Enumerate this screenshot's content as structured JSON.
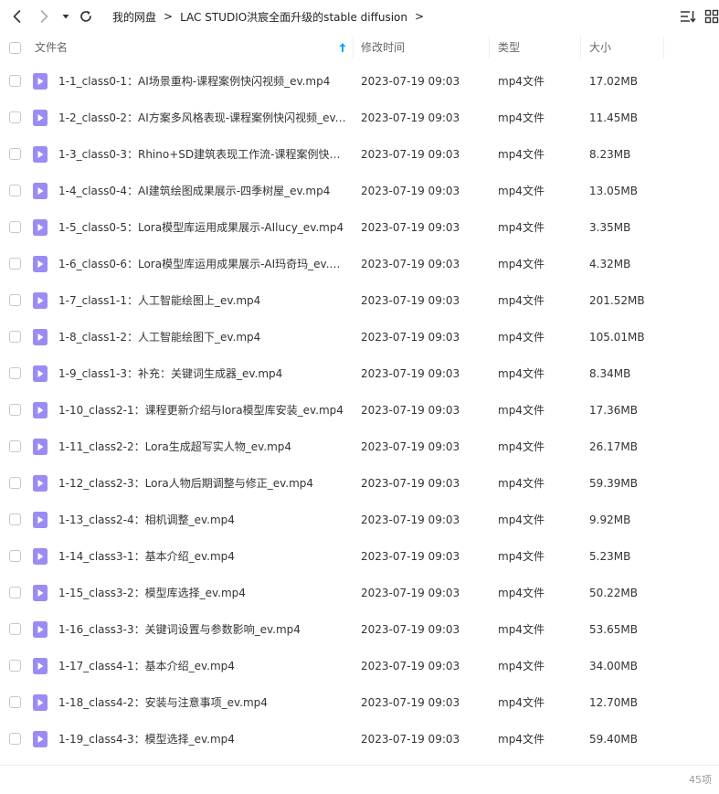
{
  "toolbar": {
    "back_icon": "chevron-left-icon",
    "forward_icon": "chevron-right-icon",
    "history_icon": "caret-down-icon",
    "refresh_icon": "refresh-icon",
    "sort_icon": "sort-list-icon",
    "grid_icon": "grid-view-icon"
  },
  "breadcrumb": {
    "items": [
      "我的网盘",
      "LAC STUDIO洪宸全面升级的stable diffusion"
    ],
    "separator": ">"
  },
  "columns": {
    "name": "文件名",
    "time": "修改时间",
    "type": "类型",
    "size": "大小"
  },
  "colors": {
    "accent": "#06a7ff",
    "file_icon": "#9b8cf4"
  },
  "files": [
    {
      "name": "1-1_class0-1：AI场景重构-课程案例快闪视频_ev.mp4",
      "time": "2023-07-19 09:03",
      "type": "mp4文件",
      "size": "17.02MB"
    },
    {
      "name": "1-2_class0-2：AI方案多风格表现-课程案例快闪视频_ev....",
      "time": "2023-07-19 09:03",
      "type": "mp4文件",
      "size": "11.45MB"
    },
    {
      "name": "1-3_class0-3：Rhino+SD建筑表现工作流-课程案例快闪...",
      "time": "2023-07-19 09:03",
      "type": "mp4文件",
      "size": "8.23MB"
    },
    {
      "name": "1-4_class0-4：AI建筑绘图成果展示-四季树屋_ev.mp4",
      "time": "2023-07-19 09:03",
      "type": "mp4文件",
      "size": "13.05MB"
    },
    {
      "name": "1-5_class0-5：Lora模型库运用成果展示-AIlucy_ev.mp4",
      "time": "2023-07-19 09:03",
      "type": "mp4文件",
      "size": "3.35MB"
    },
    {
      "name": "1-6_class0-6：Lora模型库运用成果展示-AI玛奇玛_ev.m...",
      "time": "2023-07-19 09:03",
      "type": "mp4文件",
      "size": "4.32MB"
    },
    {
      "name": "1-7_class1-1：人工智能绘图上_ev.mp4",
      "time": "2023-07-19 09:03",
      "type": "mp4文件",
      "size": "201.52MB"
    },
    {
      "name": "1-8_class1-2：人工智能绘图下_ev.mp4",
      "time": "2023-07-19 09:03",
      "type": "mp4文件",
      "size": "105.01MB"
    },
    {
      "name": "1-9_class1-3：补充：关键词生成器_ev.mp4",
      "time": "2023-07-19 09:03",
      "type": "mp4文件",
      "size": "8.34MB"
    },
    {
      "name": "1-10_class2-1：课程更新介绍与lora模型库安装_ev.mp4",
      "time": "2023-07-19 09:03",
      "type": "mp4文件",
      "size": "17.36MB"
    },
    {
      "name": "1-11_class2-2：Lora生成超写实人物_ev.mp4",
      "time": "2023-07-19 09:03",
      "type": "mp4文件",
      "size": "26.17MB"
    },
    {
      "name": "1-12_class2-3：Lora人物后期调整与修正_ev.mp4",
      "time": "2023-07-19 09:03",
      "type": "mp4文件",
      "size": "59.39MB"
    },
    {
      "name": "1-13_class2-4：相机调整_ev.mp4",
      "time": "2023-07-19 09:03",
      "type": "mp4文件",
      "size": "9.92MB"
    },
    {
      "name": "1-14_class3-1：基本介绍_ev.mp4",
      "time": "2023-07-19 09:03",
      "type": "mp4文件",
      "size": "5.23MB"
    },
    {
      "name": "1-15_class3-2：模型库选择_ev.mp4",
      "time": "2023-07-19 09:03",
      "type": "mp4文件",
      "size": "50.22MB"
    },
    {
      "name": "1-16_class3-3：关键词设置与参数影响_ev.mp4",
      "time": "2023-07-19 09:03",
      "type": "mp4文件",
      "size": "53.65MB"
    },
    {
      "name": "1-17_class4-1：基本介绍_ev.mp4",
      "time": "2023-07-19 09:03",
      "type": "mp4文件",
      "size": "34.00MB"
    },
    {
      "name": "1-18_class4-2：安装与注意事项_ev.mp4",
      "time": "2023-07-19 09:03",
      "type": "mp4文件",
      "size": "12.70MB"
    },
    {
      "name": "1-19_class4-3：模型选择_ev.mp4",
      "time": "2023-07-19 09:03",
      "type": "mp4文件",
      "size": "59.40MB"
    }
  ],
  "footer": {
    "count": "45项"
  }
}
